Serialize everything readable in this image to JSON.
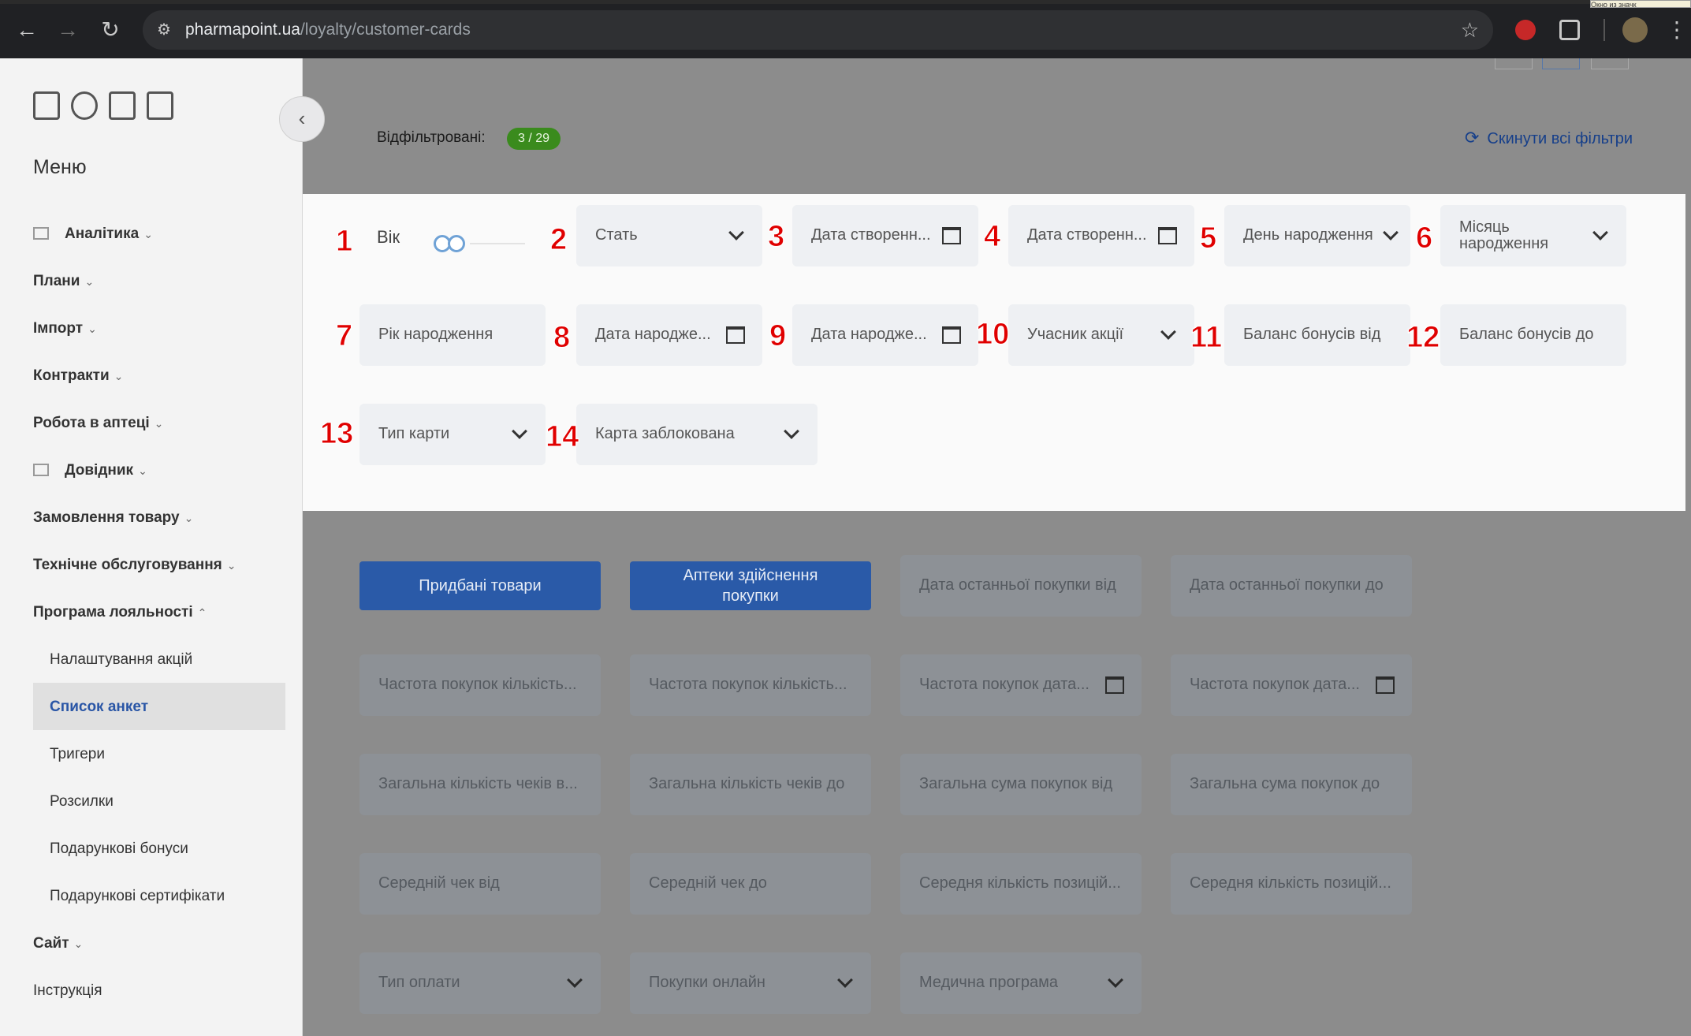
{
  "browser": {
    "url_host": "pharmapoint.ua",
    "url_path": "/loyalty/customer-cards",
    "tooltip": "Окно из значк"
  },
  "sidebar": {
    "menu_title": "Меню",
    "items": [
      {
        "label": "Аналітика",
        "chevron": "⌄"
      },
      {
        "label": "Плани",
        "chevron": "⌄"
      },
      {
        "label": "Імпорт",
        "chevron": "⌄"
      },
      {
        "label": "Контракти",
        "chevron": "⌄"
      },
      {
        "label": "Робота в аптеці",
        "chevron": "⌄"
      },
      {
        "label": "Довідник",
        "chevron": "⌄"
      },
      {
        "label": "Замовлення товару",
        "chevron": "⌄"
      },
      {
        "label": "Технічне обслуговування",
        "chevron": "⌄"
      },
      {
        "label": "Програма лояльності",
        "chevron": "⌃"
      },
      {
        "label": "Сайт",
        "chevron": "⌄"
      },
      {
        "label": "Інструкція",
        "chevron": ""
      }
    ],
    "subitems": [
      {
        "label": "Налаштування акцій"
      },
      {
        "label": "Список анкет"
      },
      {
        "label": "Тригери"
      },
      {
        "label": "Розсилки"
      },
      {
        "label": "Подарункові бонуси"
      },
      {
        "label": "Подарункові сертифікати"
      }
    ]
  },
  "header": {
    "filtered_label": "Відфільтровані:",
    "filtered_count": "3 / 29",
    "reset_label": "Скинути всі фільтри"
  },
  "filters": {
    "age_label": "Вік",
    "f2": "Стать",
    "f3": "Дата створенн...",
    "f4": "Дата створенн...",
    "f5": "День народження",
    "f6": "Місяць народження",
    "f7": "Рік народження",
    "f8": "Дата народже...",
    "f9": "Дата народже...",
    "f10": "Учасник акції",
    "f11": "Баланс бонусів від",
    "f12": "Баланс бонусів до",
    "f13": "Тип карти",
    "f14": "Карта заблокована"
  },
  "annotations": [
    "1",
    "2",
    "3",
    "4",
    "5",
    "6",
    "7",
    "8",
    "9",
    "10",
    "11",
    "12",
    "13",
    "14"
  ],
  "lower": {
    "btn_goods": "Придбані товари",
    "btn_pharmacies": "Аптеки здійснення покупки",
    "last_from": "Дата останньої покупки від",
    "last_to": "Дата останньої покупки до",
    "freq1": "Частота покупок кількість...",
    "freq2": "Частота покупок кількість...",
    "freq3": "Частота покупок дата...",
    "freq4": "Частота покупок дата...",
    "checks_from": "Загальна кількість чеків в...",
    "checks_to": "Загальна кількість чеків до",
    "sum_from": "Загальна сума покупок від",
    "sum_to": "Загальна сума покупок до",
    "avg_from": "Середній чек від",
    "avg_to": "Середній чек до",
    "avgpos_from": "Середня кількість позицій...",
    "avgpos_to": "Середня кількість позицій...",
    "pay_type": "Тип оплати",
    "online": "Покупки онлайн",
    "medical": "Медична програма"
  },
  "colors": {
    "primary": "#2a5aa8",
    "badge": "#3a8b1d",
    "annotation": "#e00000"
  }
}
